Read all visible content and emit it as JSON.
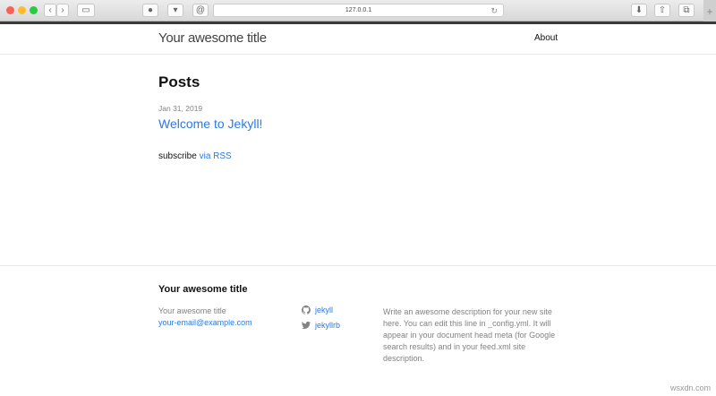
{
  "browser": {
    "url": "127.0.0.1",
    "new_tab": "+"
  },
  "header": {
    "site_title": "Your awesome title",
    "nav": [
      {
        "label": "About"
      }
    ]
  },
  "main": {
    "heading": "Posts",
    "posts": [
      {
        "date": "Jan 31, 2019",
        "title": "Welcome to Jekyll!"
      }
    ],
    "subscribe_text": "subscribe",
    "subscribe_link": "via RSS"
  },
  "footer": {
    "title": "Your awesome title",
    "name": "Your awesome title",
    "email": "your-email@example.com",
    "github": "jekyll",
    "twitter": "jekyllrb",
    "description": "Write an awesome description for your new site here. You can edit this line in _config.yml. It will appear in your document head meta (for Google search results) and in your feed.xml site description."
  },
  "watermark": "wsxdn.com"
}
